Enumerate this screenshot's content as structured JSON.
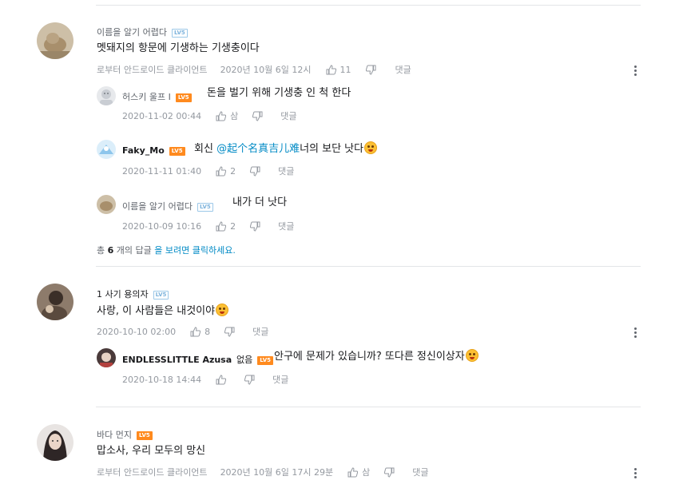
{
  "comments": [
    {
      "user": "이름을 알기 어렵다",
      "level": "LV5",
      "text": "멧돼지의 항문에 기생하는 기생충이다",
      "source": "로부터 안드로이드 클라이언트",
      "date": "2020년 10월 6일 12시",
      "likes": "11",
      "reply_label": "댓글",
      "replies": [
        {
          "user": "허스키 울프 I",
          "level": "LV5",
          "text": "돈을 벌기 위해 기생충 인 척 한다",
          "date": "2020-11-02 00:44",
          "likes": "삼",
          "reply_label": "댓글"
        },
        {
          "user": "Faky_Mo",
          "level": "LV5",
          "text_prefix": "회신 ",
          "mention": "@起个名真吉儿难",
          "text_suffix": "너의 보단 낫다",
          "date": "2020-11-11 01:40",
          "likes": "2",
          "reply_label": "댓글"
        },
        {
          "user": "이름을 알기 어렵다",
          "level": "LV5",
          "text": "내가 더 낫다",
          "date": "2020-10-09 10:16",
          "likes": "2",
          "reply_label": "댓글"
        }
      ],
      "view_more": {
        "prefix": "총 ",
        "count": "6",
        "middle": " 개의 답글 ",
        "link": "을 보려면 클릭하세요."
      }
    },
    {
      "user": "1 사기 용의자",
      "level": "LV5",
      "text": "사랑, 이 사람들은 내것이야",
      "date": "2020-10-10 02:00",
      "likes": "8",
      "reply_label": "댓글",
      "replies": [
        {
          "user": "ENDLESSLITTLE Azusa",
          "user_suffix": "없음",
          "level": "LV5",
          "text": "안구에 문제가 있습니까? 또다른 정신이상자",
          "date": "2020-10-18 14:44",
          "likes": "",
          "reply_label": "댓글"
        }
      ]
    },
    {
      "user": "바다 먼지",
      "level": "LV5",
      "text": "맙소사, 우리 모두의 망신",
      "source": "로부터 안드로이드 클라이언트",
      "date": "2020년 10월 6일 17시 29분",
      "likes": "삼",
      "reply_label": "댓글"
    }
  ],
  "colors": {
    "link": "#008ac5",
    "meta": "#9499a0",
    "level_orange": "#ff8a1e",
    "level_blue": "#7db3dc"
  }
}
